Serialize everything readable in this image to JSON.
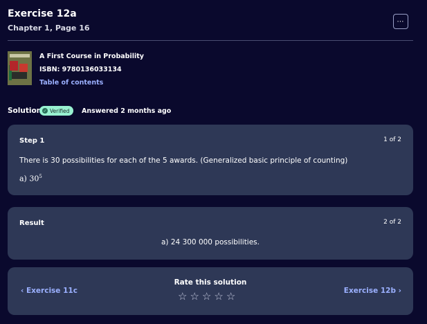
{
  "header": {
    "title": "Exercise 12a",
    "subtitle": "Chapter 1, Page 16",
    "more_icon": "⋯"
  },
  "book": {
    "title": "A First Course in Probability",
    "isbn": "ISBN: 9780136033134",
    "toc_link": "Table of contents"
  },
  "solution": {
    "label": "Solution",
    "badge": "Verified",
    "answered": "Answered 2 months ago"
  },
  "step": {
    "heading": "Step 1",
    "count": "1 of 2",
    "text": "There is 30 possibilities for each of the 5 awards. (Generalized basic principle of counting)",
    "answer_prefix": "a) 30",
    "answer_exponent": "5"
  },
  "result": {
    "heading": "Result",
    "count": "2 of 2",
    "text": "a) 24 300 000 possibilities."
  },
  "footer": {
    "prev_label": "‹  Exercise 11c",
    "next_label": "Exercise 12b  ›",
    "rate_label": "Rate this solution",
    "stars": [
      "☆",
      "☆",
      "☆",
      "☆",
      "☆"
    ]
  },
  "colors": {
    "background": "#0a092d",
    "card": "#2e3856",
    "link": "#9bb0ff",
    "badge": "#98f1d1"
  }
}
